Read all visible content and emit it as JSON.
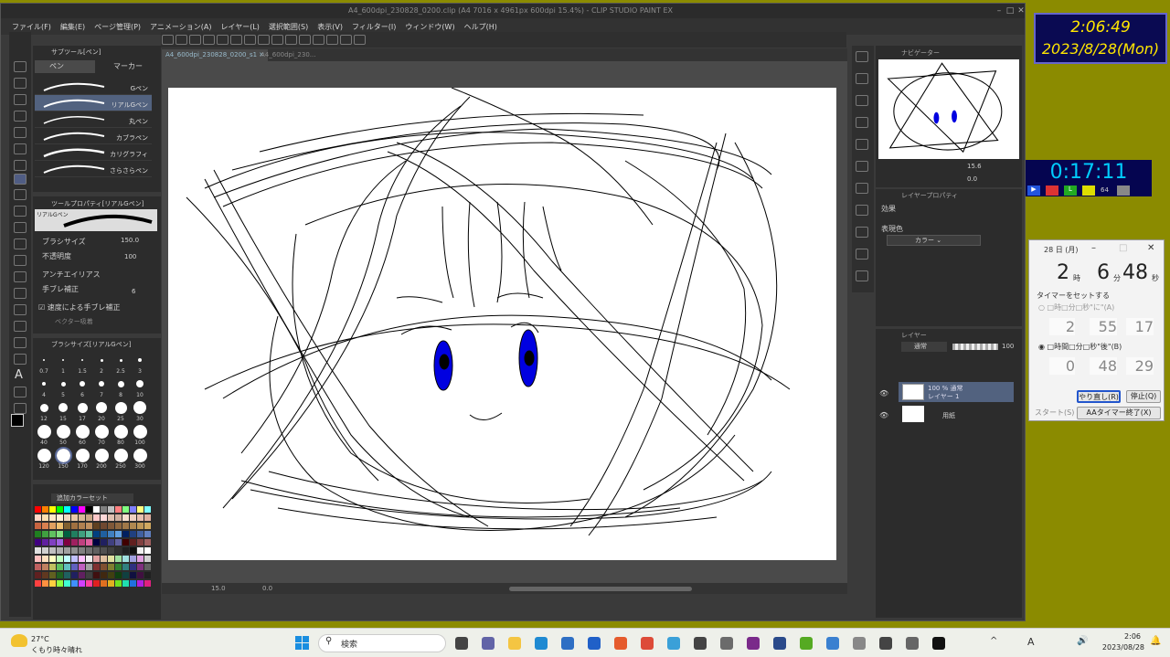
{
  "app": {
    "title": "A4_600dpi_230828_0200.clip (A4 7016 x 4961px 600dpi 15.4%) - CLIP STUDIO PAINT EX"
  },
  "menu": [
    "ファイル(F)",
    "編集(E)",
    "ページ管理(P)",
    "アニメーション(A)",
    "レイヤー(L)",
    "選択範囲(S)",
    "表示(V)",
    "フィルター(I)",
    "ウィンドウ(W)",
    "ヘルプ(H)"
  ],
  "tabs": [
    "A4_600dpi_230828_0200_s1",
    "A4_600dpi_230..."
  ],
  "sub_tool": {
    "header": "サブツール[ペン]",
    "tab1": "ペン",
    "tab2": "マーカー",
    "brushes": [
      "Gペン",
      "リアルGペン",
      "丸ペン",
      "カブラペン",
      "カリグラフィ",
      "さらさらペン"
    ]
  },
  "tool_property": {
    "header": "ツールプロパティ[リアルGペン]",
    "brush_label": "リアルGペン",
    "rows": [
      {
        "label": "ブラシサイズ",
        "value": "150.0"
      },
      {
        "label": "不透明度",
        "value": "100"
      },
      {
        "label": "アンチエイリアス",
        "value": ""
      },
      {
        "label": "手ブレ補正",
        "value": "6"
      },
      {
        "label": "速度による手ブレ補正",
        "value": ""
      },
      {
        "label": "ベクター吸着",
        "value": ""
      }
    ]
  },
  "brush_sizes": {
    "header": "ブラシサイズ[リアルGペン]",
    "sizes": [
      "0.7",
      "1",
      "1.5",
      "2",
      "2.5",
      "3",
      "4",
      "5",
      "6",
      "7",
      "8",
      "10",
      "12",
      "15",
      "17",
      "20",
      "25",
      "30",
      "40",
      "50",
      "60",
      "70",
      "80",
      "100",
      "120",
      "150",
      "170",
      "200",
      "250",
      "300"
    ]
  },
  "color_set": {
    "header": "追加カラーセット"
  },
  "status": {
    "zoom": "15.0",
    "angle": "0.0"
  },
  "navigator": {
    "header": "ナビゲーター",
    "zoom": "15.6",
    "angle": "0.0"
  },
  "layer_property": {
    "header": "レイヤープロパティ",
    "effect": "効果",
    "expression_color": "表現色",
    "color_option": "カラー"
  },
  "layers": {
    "header": "レイヤー",
    "blend_mode": "通常",
    "opacity": "100",
    "items": [
      {
        "name": "100 % 通常",
        "sub": "レイヤー 1"
      },
      {
        "name": "用紙",
        "sub": ""
      }
    ]
  },
  "clock_widget": {
    "time": "2:06:49",
    "date": "2023/8/28(Mon)"
  },
  "stopwatch": {
    "time": "0:17:11",
    "value": "64"
  },
  "timer_window": {
    "title": "28 日 (月)",
    "hour": "2",
    "hour_unit": "時",
    "minute": "6",
    "minute_unit": "分",
    "second": "48",
    "second_unit": "秒",
    "set_label": "タイマーをセットする",
    "option1": "□時□分□秒\"に\"(A)",
    "option1_values": [
      "2",
      "55",
      "17"
    ],
    "option2": "□時間□分□秒\"後\"(B)",
    "option2_values": [
      "0",
      "48",
      "29"
    ],
    "btn_redo": "やり直し(R)",
    "btn_stop": "停止(Q)",
    "btn_start": "スタート(S)",
    "btn_exit": "AAタイマー終了(X)"
  },
  "taskbar": {
    "weather_temp": "27°C",
    "weather_text": "くもり時々晴れ",
    "search": "検索",
    "time": "2:06",
    "date": "2023/08/28",
    "lang": "A"
  }
}
